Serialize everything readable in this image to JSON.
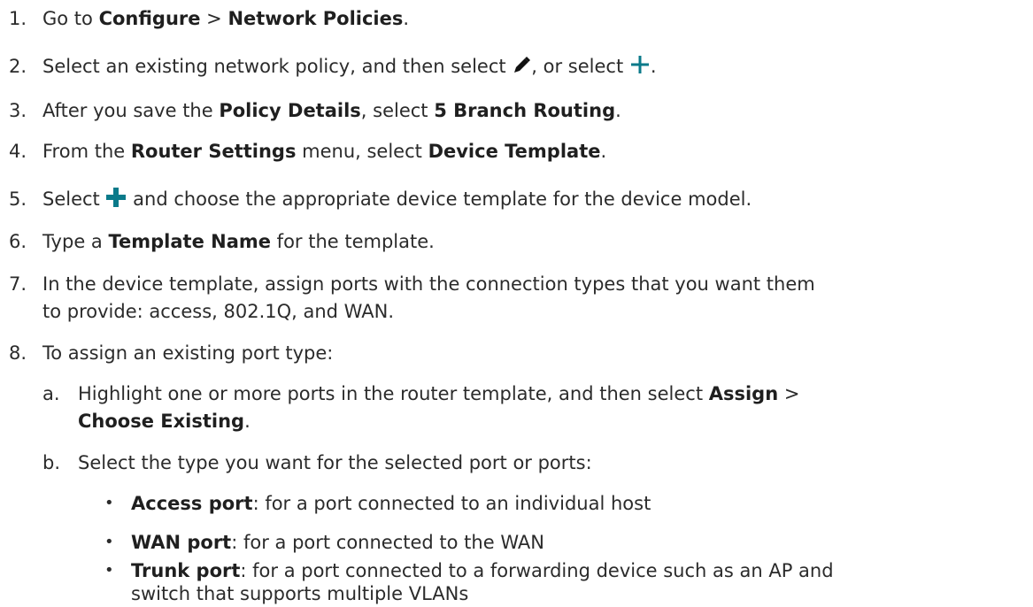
{
  "steps": [
    {
      "num": "1.",
      "p1": "Go to ",
      "b1": "Configure",
      "p2": " > ",
      "b2": "Network Policies",
      "p3": "."
    },
    {
      "num": "2.",
      "p1": "Select an existing network policy, and then select ",
      "p2": ", or select ",
      "p3": ".",
      "icon1": "pencil-icon",
      "icon2": "plus-icon"
    },
    {
      "num": "3.",
      "p1": "After you save the ",
      "b1": "Policy Details",
      "p2": ", select ",
      "b2": "5 Branch Routing",
      "p3": "."
    },
    {
      "num": "4.",
      "p1": "From the ",
      "b1": "Router Settings",
      "p2": " menu, select ",
      "b2": "Device Template",
      "p3": "."
    },
    {
      "num": "5.",
      "p1": "Select ",
      "p2": " and choose the appropriate device template for the device model.",
      "icon": "plus-icon"
    },
    {
      "num": "6.",
      "p1": "Type a ",
      "b1": "Template Name",
      "p2": " for the template."
    },
    {
      "num": "7.",
      "line1": "In the device template, assign ports with the connection types that you want them",
      "line2": "to provide: access, 802.1Q, and WAN."
    },
    {
      "num": "8.",
      "p1": "To assign an existing port type:"
    }
  ],
  "substeps": [
    {
      "num": "a.",
      "line1": "Highlight one or more ports in the router template, and then select ",
      "b1": "Assign",
      "p2": " >",
      "b2": "Choose Existing",
      "p3": "."
    },
    {
      "num": "b.",
      "p1": "Select the type you want for the selected port or ports:"
    }
  ],
  "bullets": [
    {
      "bullet": "•",
      "b": "Access port",
      "p": ": for a port connected to an individual host"
    },
    {
      "bullet": "•",
      "b": "WAN port",
      "p": ": for a port connected to the WAN"
    },
    {
      "bullet": "•",
      "b": "Trunk port",
      "p": ": for a port connected to a forwarding device such as an AP and",
      "line2": "switch that supports multiple VLANs"
    }
  ],
  "colors": {
    "text": "#2b2b2b",
    "icon_dark": "#111111",
    "icon_teal": "#0a7a8a"
  }
}
